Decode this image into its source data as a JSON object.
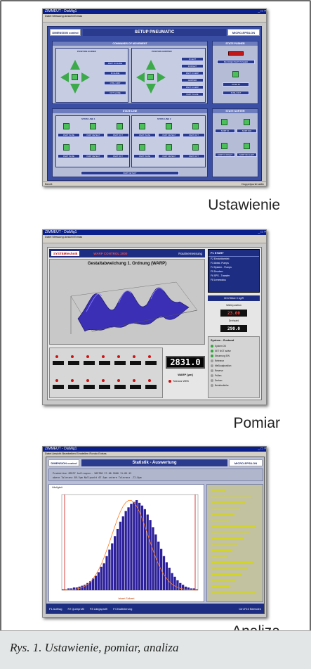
{
  "captions": {
    "setup": "Ustawienie",
    "measure": "Pomiar",
    "analysis": "Analiza",
    "figure": "Rys. 1. Ustawienie, pomiar, analiza"
  },
  "setup": {
    "window_title": "ZIMMEUT - DiaMig1",
    "menu": "Datei  Messung  Ansicht  Extras",
    "logo_left": "DIMENSION control",
    "title": "SETUP PNEUMATIC",
    "logo_right": "MICRO-EPSILON",
    "commands_head": "COMMANDS OF MOVEMENT",
    "pos_guider": "POSITION GUIDER",
    "pos_gripper": "POSITION GRIPPER",
    "state_pusher": "STATE PUSHER",
    "state_line": "STATE LINE",
    "line1": "STATE LINE 1",
    "line2": "STATE LINE 2",
    "state_sorter": "STATE SORTER",
    "left_btns": [
      "PART IN GUIDE",
      "IN GUIDE",
      "CTRL GRIP",
      "OUT GUIDE"
    ],
    "right_btns": [
      "IN LEFT",
      "IN RIGHT",
      "PART IN GRIP",
      "GRIPPER",
      "PART IN GRIP",
      "PART PLACE"
    ],
    "pusher_btns": [
      "BLOCKED PART PUSHER",
      "PUSH IN",
      "PUSH OUT"
    ],
    "row_btns": [
      "PART IN ME",
      "PART DETECT",
      "PART OUT"
    ],
    "sorter_btns": [
      "SORT IO",
      "SORT NIO",
      "SORT IO RIGHT",
      "SORT NIO LEFT"
    ],
    "status_left": "Bereit",
    "status_right": "Doppelpunkt aktiv"
  },
  "measure": {
    "window_title": "ZIMMEUT - DiaMig1",
    "menu": "Datei  Messung  Ansicht  Extras",
    "brand": "SYSTEMtechnik",
    "title_mid": "WARP CONTROL 2000",
    "title_right": "Routinemessung",
    "chart_title": "Gestaltabweichung 1. Ordnung (WARP)",
    "side_head": "F1 START",
    "side_items": [
      "F2 Einrichtbetrieb",
      "F3 Abbst. Pumps",
      "F4 System - Pumps",
      "F5 Drucken",
      "F6 SPS - Transfer",
      "F8 Lernmodus"
    ],
    "reading_label": "CD1784ce 0 kg/R",
    "wafer_label": "Waferposition",
    "wafer_value": "23.00",
    "serial_label": "Drehzahl",
    "serial_value": "290.0",
    "big_value": "2831.0",
    "big_unit": "WARP [µm]",
    "big_caption": "Toleranz WEB",
    "state_head": "System - Zustand",
    "states": [
      "System OK",
      "SET NOT active",
      "Steuerung EIN",
      "Referenz",
      "Meßkopfposition",
      "Reserve",
      "Prüfen",
      "Drehen",
      "Betriebsfehler"
    ]
  },
  "analysis": {
    "window_title": "ZIMMEUT - DiaMig1",
    "menu": "Datei  Ansicht  Bearbeiten  Einstellen  Rondo  Extras",
    "logo_left": "DIMENSION control",
    "title": "Statistik - Auswertung",
    "logo_right": "MICRO-EPSILON",
    "info_line1": "Produktion      89537    Auftragsnr.    569788      27.06.2000  11:05:12",
    "info_line2": "obere Toleranz    89.5µm    Nullpunkt    67.5µm    untere Toleranz    -72.8µm",
    "chart_label": "Häufigkeit",
    "x_label": "Istwert  Sollwert",
    "footer_items": [
      "F1 Auftrag",
      "F2 Querprofil",
      "F3 Längsprofil",
      "F4 Kalibrierung"
    ],
    "footer_right": "Ctrl-F10 Beenden"
  },
  "chart_data": {
    "type": "bar",
    "title": "",
    "ylabel": "Häufigkeit",
    "values": [
      1,
      1,
      2,
      2,
      3,
      3,
      4,
      5,
      6,
      8,
      10,
      13,
      16,
      20,
      26,
      30,
      38,
      45,
      52,
      60,
      68,
      76,
      82,
      88,
      92,
      96,
      98,
      100,
      97,
      94,
      90,
      84,
      78,
      70,
      62,
      54,
      46,
      38,
      31,
      25,
      19,
      15,
      11,
      8,
      6,
      4,
      3,
      2,
      2,
      1
    ]
  }
}
